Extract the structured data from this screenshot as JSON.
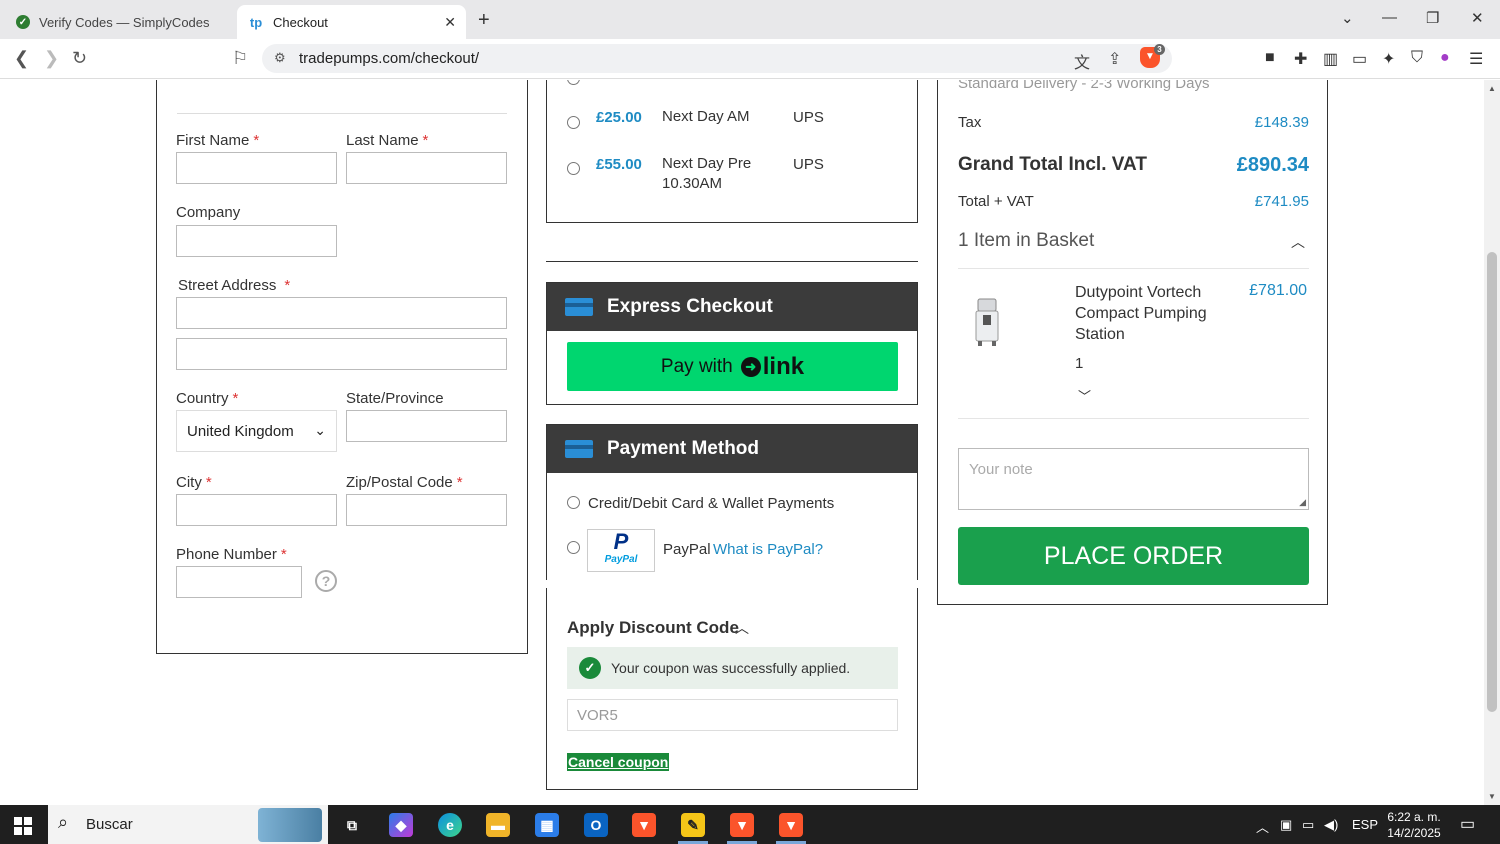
{
  "browser": {
    "tabs": [
      {
        "title": "Verify Codes — SimplyCodes",
        "favicon": "simplycodes-icon"
      },
      {
        "title": "Checkout",
        "favicon": "tradepumps-icon",
        "favicon_text": "tp"
      }
    ],
    "url": "tradepumps.com/checkout/",
    "brave_shield_count": "3"
  },
  "address_form": {
    "first_name_label": "First Name",
    "last_name_label": "Last Name",
    "company_label": "Company",
    "street_label": "Street Address",
    "country_label": "Country",
    "country_value": "United Kingdom",
    "state_label": "State/Province",
    "city_label": "City",
    "zip_label": "Zip/Postal Code",
    "phone_label": "Phone Number",
    "required_mark": "*",
    "help_symbol": "?"
  },
  "shipping": {
    "options": [
      {
        "price": "£25.00",
        "name": "Next Day AM",
        "carrier": "UPS"
      },
      {
        "price": "£55.00",
        "name": "Next Day Pre 10.30AM",
        "carrier": "UPS"
      }
    ]
  },
  "express_checkout": {
    "title": "Express Checkout",
    "link_button_prefix": "Pay with",
    "link_button_brand": "link"
  },
  "payment_method": {
    "title": "Payment Method",
    "card_option": "Credit/Debit Card & Wallet Payments",
    "paypal_option": "PayPal",
    "paypal_logo_text": "PayPal",
    "what_is_paypal": "What is PayPal?"
  },
  "discount": {
    "title": "Apply Discount Code",
    "success_message": "Your coupon was successfully applied.",
    "code_value": "VOR5",
    "cancel_label": "Cancel coupon"
  },
  "summary": {
    "delivery_note": "Standard Delivery - 2-3 Working Days",
    "tax_label": "Tax",
    "tax_value": "£148.39",
    "grand_total_label": "Grand Total Incl. VAT",
    "grand_total_value": "£890.34",
    "total_vat_label": "Total + VAT",
    "total_vat_value": "£741.95",
    "basket_heading": "1 Item in Basket",
    "item": {
      "name": "Dutypoint Vortech Compact Pumping Station",
      "price": "£781.00",
      "qty": "1"
    },
    "note_placeholder": "Your note",
    "place_order_label": "PLACE ORDER"
  },
  "taskbar": {
    "search_text": "Buscar",
    "language": "ESP",
    "time": "6:22 a. m.",
    "date": "14/2/2025"
  },
  "colors": {
    "accent_blue": "#1e8bc3",
    "link_green": "#00d66f",
    "place_order_green": "#1aa04d",
    "panel_header": "#3b3b3b"
  }
}
